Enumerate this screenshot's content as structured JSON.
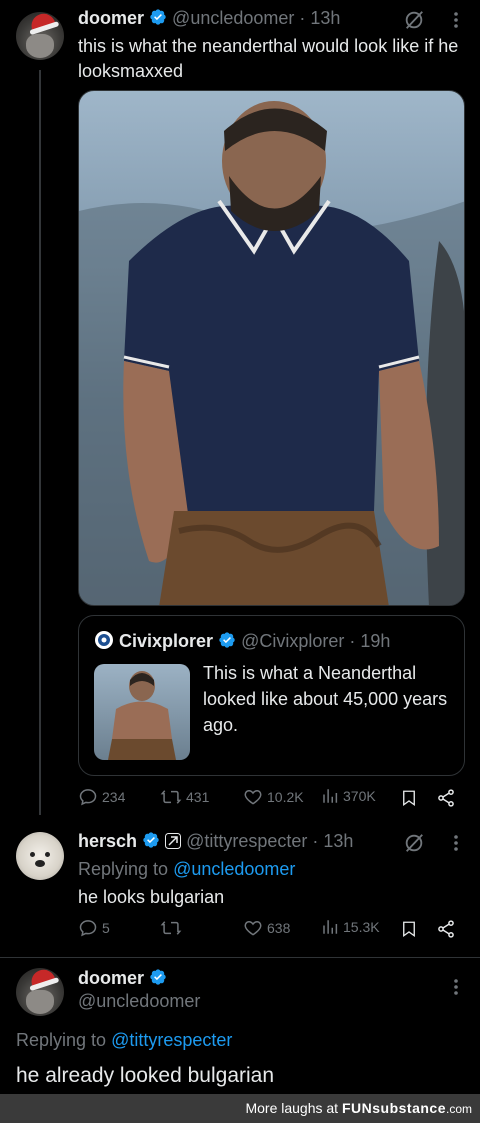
{
  "tweet1": {
    "name": "doomer",
    "handle": "@uncledoomer",
    "time": "13h",
    "text": "this is what the neanderthal would look like if he looksmaxxed",
    "quote": {
      "name": "Civixplorer",
      "handle": "@Civixplorer",
      "time": "19h",
      "text": "This is what a Neanderthal looked like about 45,000 years ago."
    },
    "actions": {
      "replies": "234",
      "reposts": "431",
      "likes": "10.2K",
      "views": "370K"
    }
  },
  "tweet2": {
    "name": "hersch",
    "handle": "@tittyrespecter",
    "time": "13h",
    "replying_label": "Replying to",
    "replying_to": "@uncledoomer",
    "text": "he looks bulgarian",
    "actions": {
      "replies": "5",
      "reposts": "",
      "likes": "638",
      "views": "15.3K"
    }
  },
  "tweet3": {
    "name": "doomer",
    "handle": "@uncledoomer",
    "replying_label": "Replying to",
    "replying_to": "@tittyrespecter",
    "text": "he already looked bulgarian"
  },
  "footer": {
    "prefix": "More laughs at",
    "brand_fun": "FUN",
    "brand_sub": "substance",
    "brand_com": ".com"
  },
  "colors": {
    "background": "#000000",
    "text": "#e7e9ea",
    "muted": "#71767b",
    "accent": "#1d9bf0",
    "verified": "#1d9bf0",
    "footer_bg": "#3a3a3a"
  },
  "icons": [
    "verified-badge-icon",
    "grok-icon",
    "more-icon",
    "reply-icon",
    "repost-icon",
    "like-icon",
    "views-icon",
    "bookmark-icon",
    "share-icon"
  ]
}
